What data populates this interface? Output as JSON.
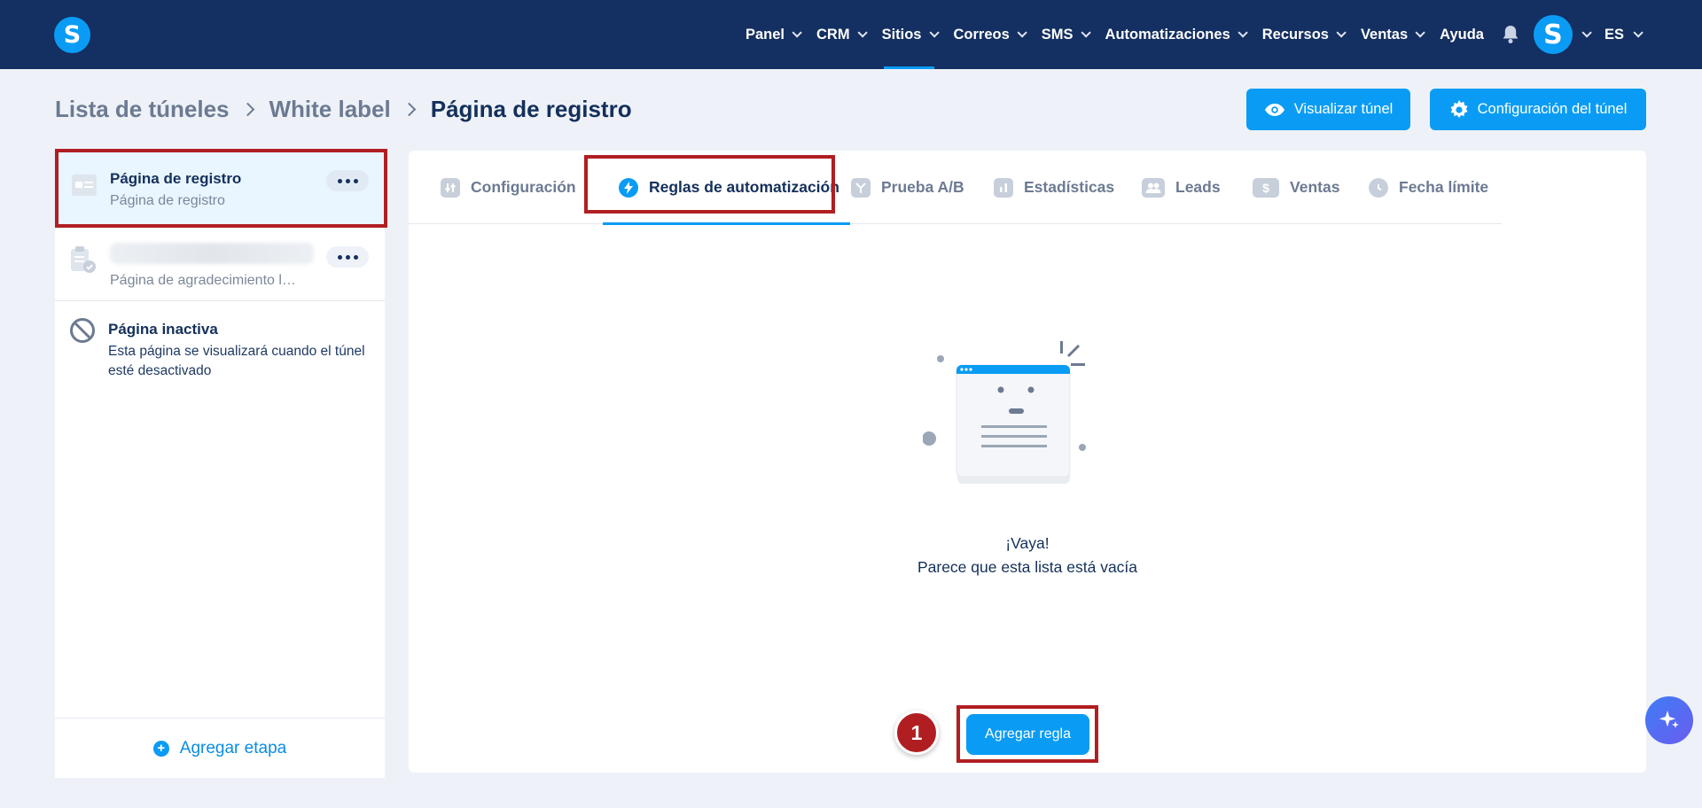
{
  "app": {
    "logo_letter": "S"
  },
  "nav": {
    "items": [
      {
        "label": "Panel",
        "has_menu": true
      },
      {
        "label": "CRM",
        "has_menu": true
      },
      {
        "label": "Sitios",
        "has_menu": true,
        "active": true
      },
      {
        "label": "Correos",
        "has_menu": true
      },
      {
        "label": "SMS",
        "has_menu": true
      },
      {
        "label": "Automatizaciones",
        "has_menu": true
      },
      {
        "label": "Recursos",
        "has_menu": true
      },
      {
        "label": "Ventas",
        "has_menu": true
      },
      {
        "label": "Ayuda",
        "has_menu": false
      }
    ],
    "notifications_icon": "bell-icon",
    "avatar_letter": "S",
    "language": "ES"
  },
  "breadcrumb": {
    "items": [
      "Lista de túneles",
      "White label",
      "Página de registro"
    ]
  },
  "header_actions": {
    "preview_label": "Visualizar túnel",
    "settings_label": "Configuración del túnel"
  },
  "steps": [
    {
      "title": "Página de registro",
      "subtitle": "Página de registro",
      "selected": true
    },
    {
      "title": "",
      "subtitle": "Página de agradecimiento l…"
    },
    {
      "title": "Página inactiva",
      "description": "Esta página se visualizará cuando el túnel esté desactivado"
    }
  ],
  "add_step_label": "Agregar etapa",
  "tabs": [
    {
      "label": "Configuración",
      "icon": "sliders-icon"
    },
    {
      "label": "Reglas de automatización",
      "icon": "lightning-icon",
      "active": true
    },
    {
      "label": "Prueba A/B",
      "icon": "split-icon"
    },
    {
      "label": "Estadísticas",
      "icon": "bar-chart-icon"
    },
    {
      "label": "Leads",
      "icon": "users-icon"
    },
    {
      "label": "Ventas",
      "icon": "dollar-icon"
    },
    {
      "label": "Fecha límite",
      "icon": "clock-icon"
    }
  ],
  "empty_state": {
    "title": "¡Vaya!",
    "message": "Parece que esta lista está vacía"
  },
  "add_rule_label": "Agregar regla",
  "annotation": {
    "step_number": "1"
  },
  "colors": {
    "nav_bg": "#142f61",
    "accent": "#0a9cf4",
    "highlight": "#b01e22",
    "page_bg": "#eef2f8"
  }
}
